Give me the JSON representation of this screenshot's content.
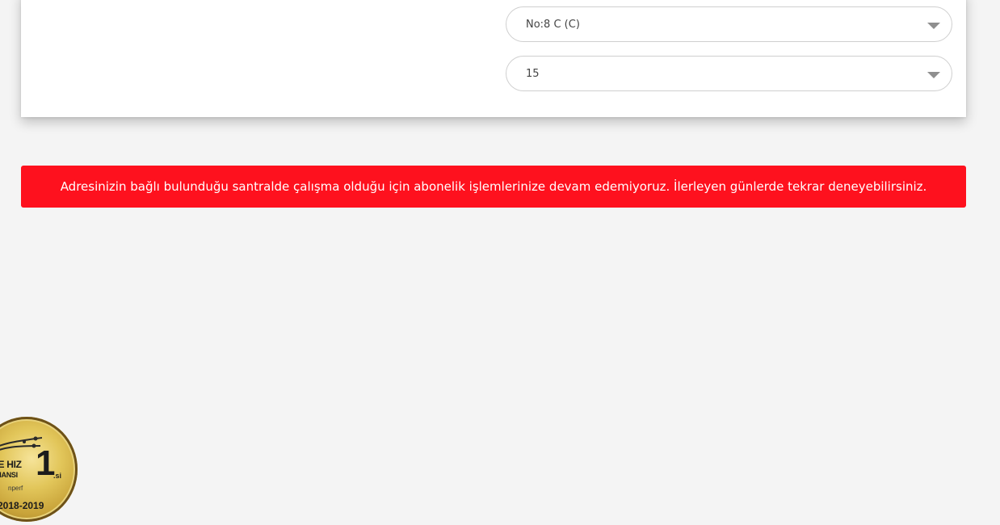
{
  "address_form": {
    "building_select": {
      "value": "No:8 C (C)"
    },
    "door_select": {
      "value": "15"
    }
  },
  "alert": {
    "message": "Adresinizin bağlı bulunduğu santralde çalışma olduğu için abonelik işlemlerinize devam edemiyoruz. İlerleyen günlerde tekrar deneyebilirsiniz.",
    "background_color": "#fe111e"
  },
  "award_badge": {
    "line1": "RKİYE HIZ",
    "line2": "RFORMANSI",
    "rank": "1",
    "rank_suffix": ".si",
    "brand": "nperf",
    "years": "2018-2019"
  }
}
